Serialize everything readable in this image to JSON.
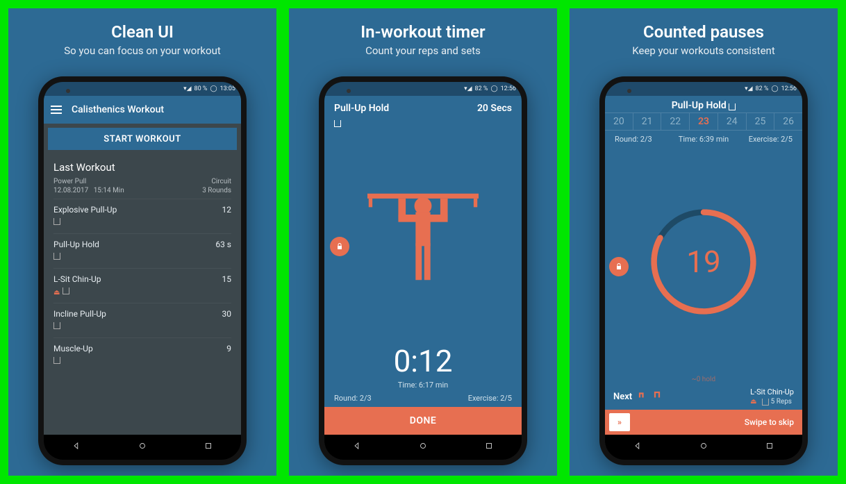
{
  "panels": [
    {
      "title": "Clean UI",
      "subtitle": "So you can focus on your workout"
    },
    {
      "title": "In-workout timer",
      "subtitle": "Count your reps and sets"
    },
    {
      "title": "Counted pauses",
      "subtitle": "Keep your workouts consistent"
    }
  ],
  "status": {
    "battery1": "80 %",
    "time1": "13:05",
    "battery2": "82 %",
    "time2": "12:56",
    "battery3": "82 %",
    "time3": "12:56"
  },
  "screen1": {
    "app_title": "Calisthenics Workout",
    "start_label": "START WORKOUT",
    "last_label": "Last Workout",
    "workout_name": "Power Pull",
    "workout_date": "12.08.2017",
    "workout_duration": "15:14 Min",
    "workout_type": "Circuit",
    "workout_rounds": "3 Rounds",
    "exercises": [
      {
        "name": "Explosive Pull-Up",
        "value": "12"
      },
      {
        "name": "Pull-Up Hold",
        "value": "63 s"
      },
      {
        "name": "L-Sit Chin-Up",
        "value": "15",
        "weighted": true
      },
      {
        "name": "Incline Pull-Up",
        "value": "30"
      },
      {
        "name": "Muscle-Up",
        "value": "9"
      }
    ]
  },
  "screen2": {
    "exercise": "Pull-Up Hold",
    "duration": "20 Secs",
    "timer": "0:12",
    "elapsed": "Time: 6:17 min",
    "round": "Round: 2/3",
    "exercise_count": "Exercise: 2/5",
    "done_label": "DONE"
  },
  "screen3": {
    "title": "Pull-Up Hold",
    "rail": [
      "20",
      "21",
      "22",
      "23",
      "24",
      "25",
      "26"
    ],
    "rail_current_index": 3,
    "elapsed": "Time: 6:39 min",
    "round": "Round: 2/3",
    "exercise_count": "Exercise: 2/5",
    "countdown": "19",
    "hold_note": "~0 hold",
    "next_label": "Next",
    "next_exercise": "L-Sit Chin-Up",
    "next_reps": "5 Reps",
    "swipe_label": "Swipe to skip",
    "swipe_icon": "»"
  }
}
